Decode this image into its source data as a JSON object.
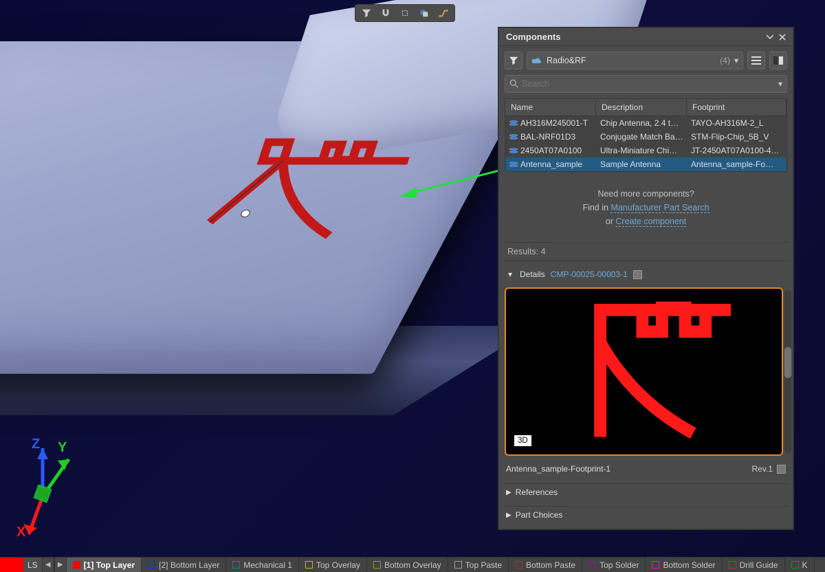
{
  "toolbar": {
    "icons": [
      "filter",
      "snap",
      "grid",
      "plane",
      "trace"
    ]
  },
  "axis": {
    "x": "X",
    "y": "Y",
    "z": "Z"
  },
  "panel": {
    "title": "Components",
    "library": {
      "name": "Radio&RF",
      "count": "(4)"
    },
    "search_placeholder": "Search",
    "columns": {
      "c1": "Name",
      "c2": "Description",
      "c3": "Footprint"
    },
    "rows": [
      {
        "name": "AH316M245001-T",
        "desc": "Chip Antenna, 2.4 t…",
        "fp": "TAYO-AH316M-2_L"
      },
      {
        "name": "BAL-NRF01D3",
        "desc": "Conjugate Match Ba…",
        "fp": "STM-Flip-Chip_5B_V"
      },
      {
        "name": "2450AT07A0100",
        "desc": "Ultra-Miniature Chi…",
        "fp": "JT-2450AT07A0100-4…"
      },
      {
        "name": "Antenna_sample",
        "desc": "Sample Antenna",
        "fp": "Antenna_sample-Fo…"
      }
    ],
    "need": {
      "line1": "Need more components?",
      "line2a": "Find in ",
      "link1": "Manufacturer Part Search",
      "line3a": "or ",
      "link2": "Create component"
    },
    "results_label": "Results:",
    "results_count": "4",
    "details": {
      "label": "Details",
      "id": "CMP-00025-00003-1"
    },
    "preview": {
      "badge": "3D",
      "name": "Antenna_sample-Footprint-1",
      "rev": "Rev.1"
    },
    "sections": {
      "references": "References",
      "part_choices": "Part Choices"
    }
  },
  "layers": {
    "big_swatch_color": "#ff0000",
    "ls": "LS",
    "tabs": [
      {
        "color": "#ff0000",
        "label": "[1] Top Layer",
        "active": true,
        "outline": false
      },
      {
        "color": "#0033ff",
        "label": "[2] Bottom Layer",
        "active": false,
        "outline": true
      },
      {
        "color": "#009080",
        "label": "Mechanical 1",
        "active": false,
        "outline": true
      },
      {
        "color": "#bfbf00",
        "label": "Top Overlay",
        "active": false,
        "outline": true
      },
      {
        "color": "#9a9a00",
        "label": "Bottom Overlay",
        "active": false,
        "outline": true
      },
      {
        "color": "#9a9a9a",
        "label": "Top Paste",
        "active": false,
        "outline": true
      },
      {
        "color": "#a03838",
        "label": "Bottom Paste",
        "active": false,
        "outline": true
      },
      {
        "color": "#aa00aa",
        "label": "Top Solder",
        "active": false,
        "outline": true
      },
      {
        "color": "#ff00ff",
        "label": "Bottom Solder",
        "active": false,
        "outline": true
      },
      {
        "color": "#b04020",
        "label": "Drill Guide",
        "active": false,
        "outline": true
      },
      {
        "color": "#00a000",
        "label": "K",
        "active": false,
        "outline": true
      }
    ]
  }
}
